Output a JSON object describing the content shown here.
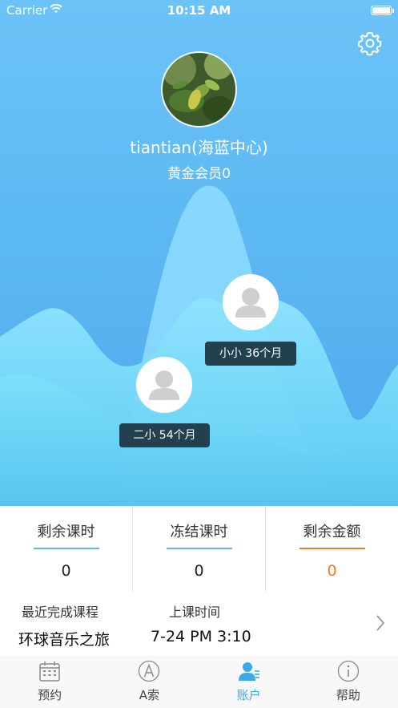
{
  "status_bar": {
    "carrier": "Carrier",
    "time": "10:15 AM"
  },
  "profile": {
    "username": "tiantian(海蓝中心)",
    "membership": "黄金会员0"
  },
  "children": [
    {
      "label": "小小 36个月"
    },
    {
      "label": "二小 54个月"
    }
  ],
  "stats": [
    {
      "label": "剩余课时",
      "value": "0",
      "accent": "#5bbbe9",
      "value_color": "#222222"
    },
    {
      "label": "冻结课时",
      "value": "0",
      "accent": "#5bbbe9",
      "value_color": "#222222"
    },
    {
      "label": "剩余金额",
      "value": "0",
      "accent": "#f07c1f",
      "value_color": "#f07c1f"
    }
  ],
  "recent": {
    "course_header": "最近完成课程",
    "time_header": "上课时间",
    "course_value": "环球音乐之旅",
    "time_value": "7-24 PM 3:10"
  },
  "tabs": [
    {
      "label": "预约",
      "icon": "calendar-icon",
      "active": false
    },
    {
      "label": "A索",
      "icon": "letter-a-icon",
      "active": false
    },
    {
      "label": "账户",
      "icon": "account-icon",
      "active": true
    },
    {
      "label": "帮助",
      "icon": "info-icon",
      "active": false
    }
  ],
  "colors": {
    "accent": "#3aa8ec",
    "hero_top": "#6cc3f8",
    "child_label_bg": "#23404f",
    "money": "#f07c1f"
  }
}
